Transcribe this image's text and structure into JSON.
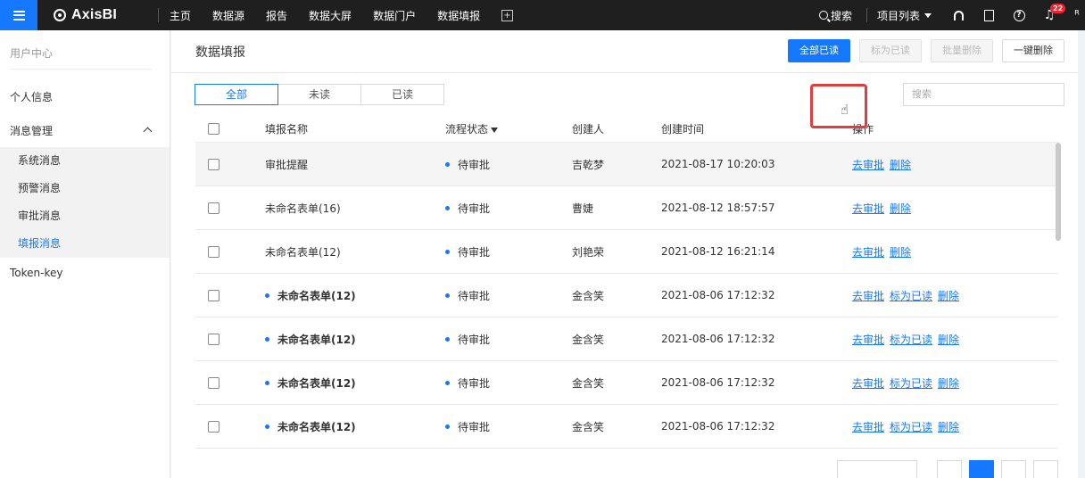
{
  "topbar": {
    "logo": "AxisBI",
    "nav": [
      "主页",
      "数据源",
      "报告",
      "数据大屏",
      "数据门户",
      "数据填报"
    ],
    "search_label": "搜索",
    "project_list": "项目列表",
    "notification_count": "22"
  },
  "sidebar": {
    "title": "用户中心",
    "personal_info": "个人信息",
    "message_mgmt": "消息管理",
    "sub_items": [
      "系统消息",
      "预警消息",
      "审批消息",
      "填报消息"
    ],
    "token_key": "Token-key"
  },
  "main": {
    "title": "数据填报",
    "actions": {
      "mark_all_read": "全部已读",
      "mark_read": "标为已读",
      "batch_delete": "批量删除",
      "delete_all": "一键删除"
    },
    "filters": [
      "全部",
      "未读",
      "已读"
    ],
    "search_placeholder": "搜索",
    "columns": {
      "name": "填报名称",
      "status": "流程状态",
      "creator": "创建人",
      "time": "创建时间",
      "ops": "操作"
    },
    "ops_labels": {
      "approve": "去审批",
      "mark_read": "标为已读",
      "delete": "删除"
    },
    "rows": [
      {
        "name": "审批提醒",
        "unread": false,
        "status": "待审批",
        "creator": "吉乾梦",
        "time": "2021-08-17 10:20:03"
      },
      {
        "name": "未命名表单(16)",
        "unread": false,
        "status": "待审批",
        "creator": "曹婕",
        "time": "2021-08-12 18:57:57"
      },
      {
        "name": "未命名表单(12)",
        "unread": false,
        "status": "待审批",
        "creator": "刘艳荣",
        "time": "2021-08-12 16:21:14"
      },
      {
        "name": "未命名表单(12)",
        "unread": true,
        "status": "待审批",
        "creator": "金含笑",
        "time": "2021-08-06 17:12:32"
      },
      {
        "name": "未命名表单(12)",
        "unread": true,
        "status": "待审批",
        "creator": "金含笑",
        "time": "2021-08-06 17:12:32"
      },
      {
        "name": "未命名表单(12)",
        "unread": true,
        "status": "待审批",
        "creator": "金含笑",
        "time": "2021-08-06 17:12:32"
      },
      {
        "name": "未命名表单(12)",
        "unread": true,
        "status": "待审批",
        "creator": "金含笑",
        "time": "2021-08-06 17:12:32"
      }
    ]
  },
  "colors": {
    "accent": "#1677ff",
    "topbar_bg": "#1f1f1f",
    "highlight_border": "#e23c3c",
    "badge": "#f5222d"
  }
}
